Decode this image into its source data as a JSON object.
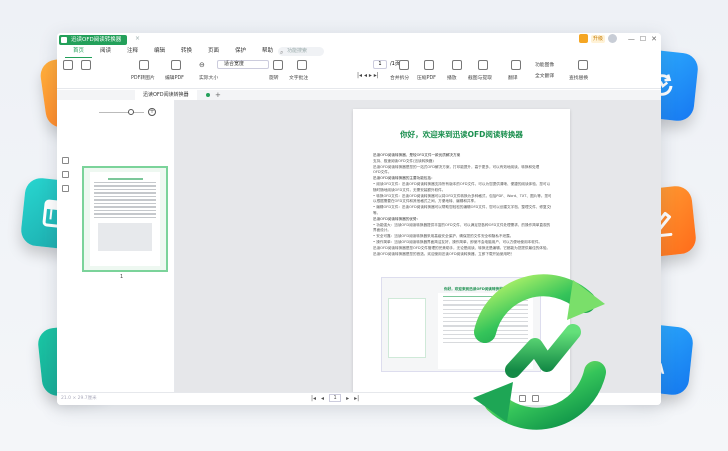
{
  "window": {
    "app_title": "迅读OFD阅读转换器",
    "tab_close": "×",
    "controls": [
      "—",
      "☐",
      "✕"
    ],
    "vip_label": "升级"
  },
  "menu": {
    "items": [
      "首页",
      "阅读",
      "注释",
      "编辑",
      "转换",
      "页面",
      "保护",
      "帮助"
    ],
    "active_index": 0,
    "search_placeholder": "功能搜索"
  },
  "toolbar": {
    "pdf_convert": "PDF转图片",
    "pdf_edit": "编辑PDF",
    "zoom": "适合宽度",
    "fit_size": "实际大小",
    "rotate": "旋转",
    "text_annot": "文字批注",
    "page_current": "1",
    "page_total": "/1页",
    "merge_split": "合并拆分",
    "compress": "压缩PDF",
    "print": "播放",
    "screenshot": "截图与提取",
    "translate": "翻译",
    "convert_full": "全文翻译",
    "search_replace": "查找替换",
    "extract_image": "功能图像",
    "single_page": "连续阅读"
  },
  "doc_tab": {
    "name": "迅读OFD阅读转换器",
    "add": "+"
  },
  "side": {
    "thumb_page_num": "1"
  },
  "page": {
    "title": "你好，欢迎来到迅读OFD阅读转换器",
    "lines": [
      "迅读OFD阅读转换器，是较OFD文件一款优质解决方案",
      "支持、极速阅读OFD文件(迅读转换器)",
      "迅读OFD阅读转换器是您的一站式OFD解决方案，打印能提升，高于更多，可以有效地阅读、转换和处理",
      "OFD文件。",
      "迅读OFD阅读转换器的主要功能包括：",
      "• 阅读OFD文件：迅读OFD阅读转换器支持所有版本的OFD文件，可以为您提供清晰、便捷的阅读体验，您可以",
      "   随时随地阅读OFD文件，无需安装额外软件。",
      "• 转换OFD文件：迅读OFD阅读转换器可以将OFD文件转换为多种格式，包括PDF、Word、TXT、图片等。您可",
      "   以根据需要在OFD文件和其他格式之间，方便地转、编辑和共享。",
      "• 编辑OFD文件：迅读OFD阅读转换器可以帮助您轻松的编辑OFD文件，您可以创建文字档、整理文件、修复文件",
      "   等。",
      "迅读OFD阅读转换器的优势：",
      "• 功能强大：迅读OFD阅读转换器提供丰富的OFD文件，可以满足您各种OFD文件处理需求，的操作简单直观的",
      "   界面设计。",
      "• 安全可靠：迅读OFD阅读转换器采用高级安全保护，确保您的文件安全和隐私不泄露。",
      "• 操作简单：迅读OFD阅读转换器界面简洁友好，操作简单，即使不会电脑用户，可以方便地使用本软件。",
      "迅读OFD阅读转换器是您OFD文件管理的完美助手，无论是阅读、转换还是编辑，它都能为您提供最佳的体验。",
      "迅读OFD阅读转换器是您的首选。欢迎使用迅读OFD阅读转换器，立即下载开始使用吧！"
    ],
    "shot_title": "你好，欢迎来到迅读OFD阅读转换器"
  },
  "status": {
    "size": "21.0 × 29.7厘米",
    "page": "1",
    "zoom": "100%"
  },
  "colors": {
    "brand": "#23a05a",
    "title_green": "#1a8f4e"
  }
}
